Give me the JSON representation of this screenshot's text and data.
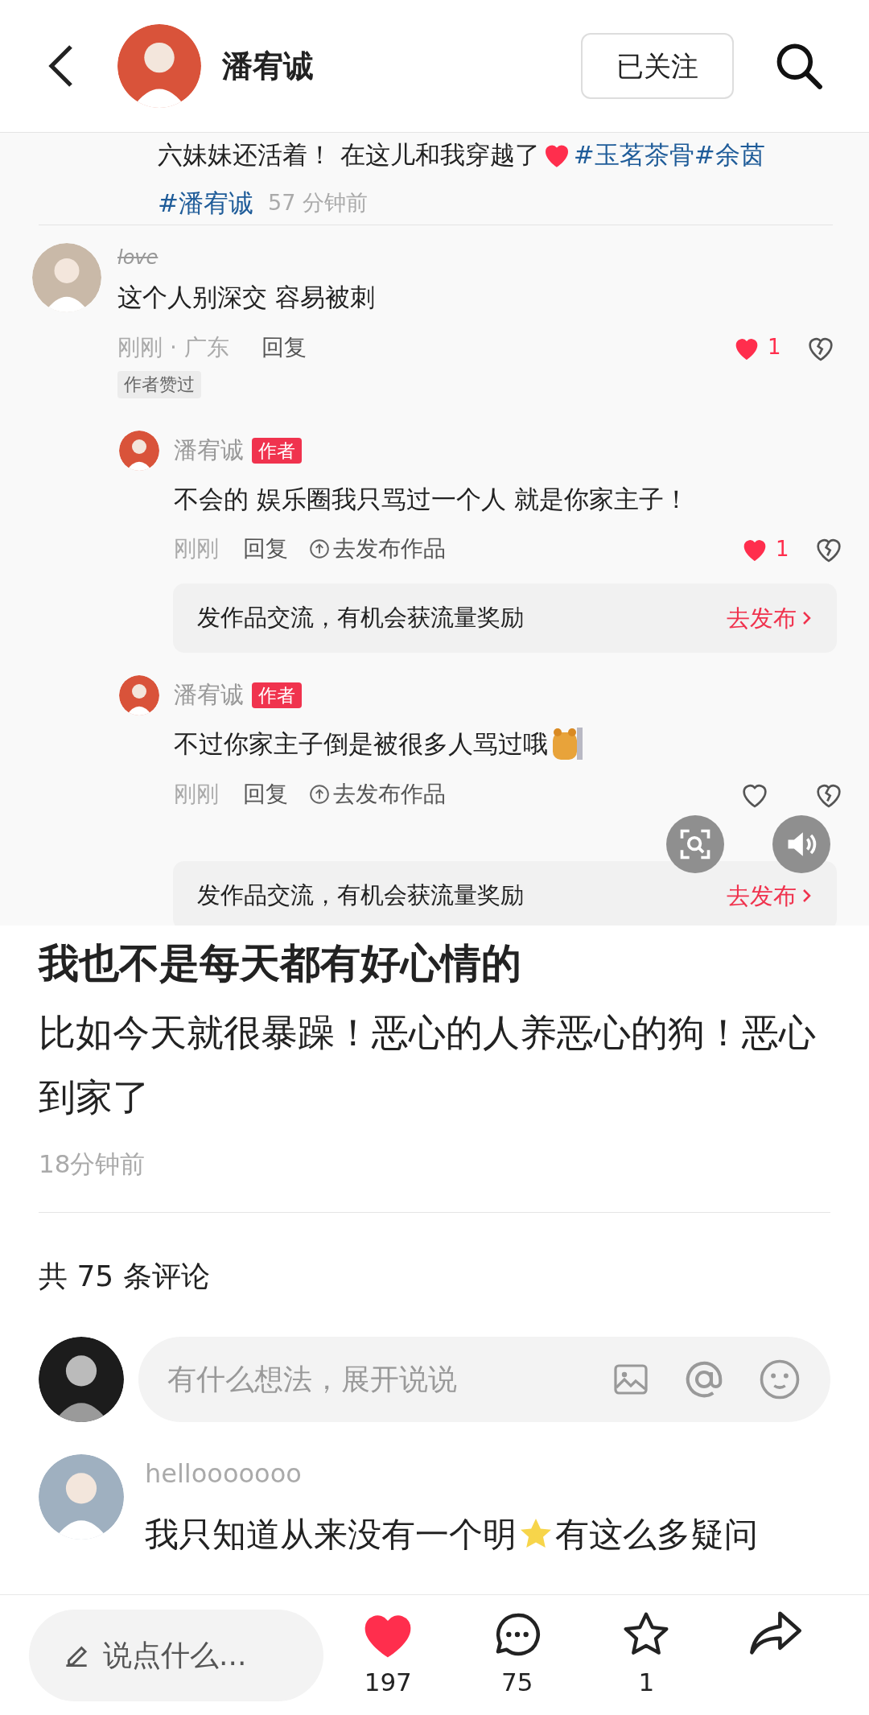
{
  "header": {
    "name": "潘宥诚",
    "follow_button": "已关注"
  },
  "shared_comments": {
    "top_comment": {
      "text": "六妹妹还活着！ 在这儿和我穿越了",
      "hashtags": [
        "#玉茗茶骨",
        "#余茵",
        "#潘宥诚"
      ],
      "time": "57 分钟前"
    },
    "comment": {
      "username": "love",
      "text": "这个人别深交 容易被刺",
      "meta": "刚刚 · 广东",
      "reply": "回复",
      "liked": true,
      "likes": "1",
      "badge": "作者赞过"
    },
    "replies": [
      {
        "username": "潘宥诚",
        "badge": "作者",
        "text": "不会的 娱乐圈我只骂过一个人 就是你家主子！",
        "emoji": false,
        "time": "刚刚",
        "reply": "回复",
        "publish": "去发布作品",
        "liked": true,
        "likes": "1",
        "promo": {
          "text": "发作品交流，有机会获流量奖励",
          "action": "去发布"
        }
      },
      {
        "username": "潘宥诚",
        "badge": "作者",
        "text": "不过你家主子倒是被很多人骂过哦",
        "emoji": true,
        "time": "刚刚",
        "reply": "回复",
        "publish": "去发布作品",
        "liked": false,
        "promo": {
          "text": "发作品交流，有机会获流量奖励",
          "action": "去发布"
        }
      }
    ]
  },
  "post": {
    "title": "我也不是每天都有好心情的",
    "body": "比如今天就很暴躁！恶心的人养恶心的狗！恶心到家了",
    "time": "18分钟前"
  },
  "comments_count": "共 75 条评论",
  "comment_input": {
    "placeholder": "有什么想法，展开说说"
  },
  "comments": [
    {
      "username": "hellooooooo",
      "text_before": "我只知道从来没有一个明",
      "text_after": "有这么多疑问"
    }
  ],
  "bottom_bar": {
    "placeholder": "说点什么...",
    "actions": [
      {
        "kind": "like",
        "count": "197",
        "selected": true
      },
      {
        "kind": "comment",
        "count": "75"
      },
      {
        "kind": "collect",
        "count": "1",
        "selected": false
      },
      {
        "kind": "share"
      }
    ]
  }
}
